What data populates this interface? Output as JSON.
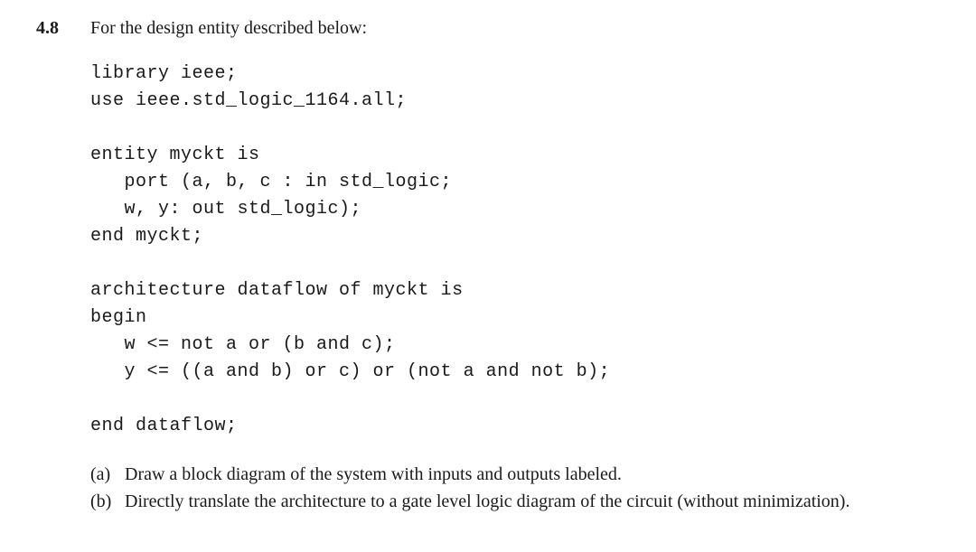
{
  "exercise": {
    "number": "4.8",
    "intro": "For the design entity described below:",
    "code": "library ieee;\nuse ieee.std_logic_1164.all;\n\nentity myckt is\n   port (a, b, c : in std_logic;\n   w, y: out std_logic);\nend myckt;\n\narchitecture dataflow of myckt is\nbegin\n   w <= not a or (b and c);\n   y <= ((a and b) or c) or (not a and not b);\n\nend dataflow;",
    "questions": [
      {
        "label": "(a)",
        "text": "Draw a block diagram of the system with inputs and outputs labeled."
      },
      {
        "label": "(b)",
        "text": "Directly translate the architecture to a gate level logic diagram of the circuit (without minimization)."
      }
    ]
  }
}
